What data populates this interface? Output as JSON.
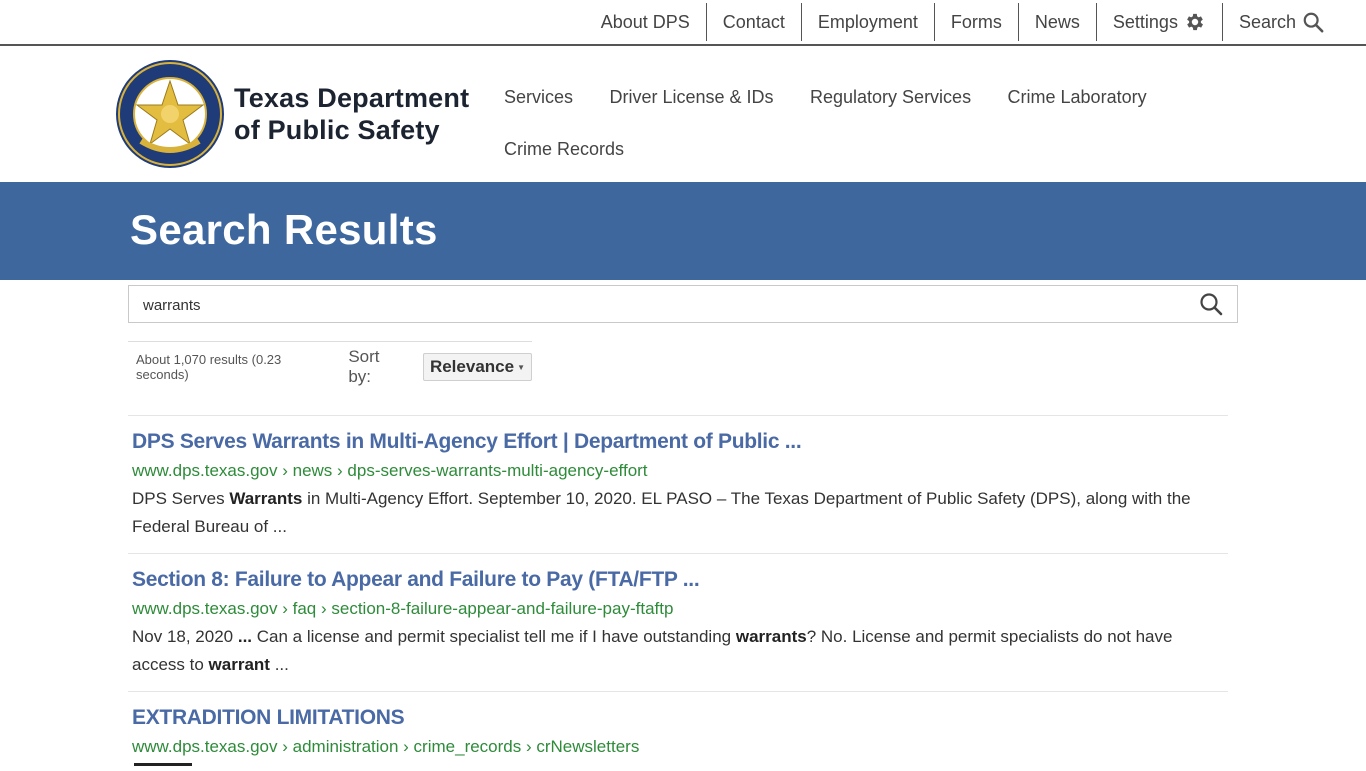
{
  "utility_nav": {
    "about": "About DPS",
    "contact": "Contact",
    "employment": "Employment",
    "forms": "Forms",
    "news": "News",
    "settings": "Settings",
    "search": "Search"
  },
  "brand": {
    "line1": "Texas Department",
    "line2": "of Public Safety"
  },
  "main_nav": {
    "services": "Services",
    "driver_license": "Driver License & IDs",
    "regulatory": "Regulatory Services",
    "crime_lab": "Crime Laboratory",
    "crime_records": "Crime Records"
  },
  "hero": {
    "title": "Search Results"
  },
  "search": {
    "query": "warrants"
  },
  "results_meta": {
    "count_text": "About 1,070 results (0.23 seconds)",
    "sort_label": "Sort by:",
    "sort_value": "Relevance"
  },
  "results": [
    {
      "title": "DPS Serves Warrants in Multi-Agency Effort | Department of Public ...",
      "url": "www.dps.texas.gov › news › dps-serves-warrants-multi-agency-effort",
      "snippet": [
        {
          "t": "DPS Serves ",
          "b": false
        },
        {
          "t": "Warrants",
          "b": true
        },
        {
          "t": " in Multi-Agency Effort. September 10, 2020. EL PASO – The Texas Department of Public Safety (DPS), along with the Federal Bureau of ...",
          "b": false
        }
      ]
    },
    {
      "title": "Section 8: Failure to Appear and Failure to Pay (FTA/FTP ...",
      "url": "www.dps.texas.gov › faq › section-8-failure-appear-and-failure-pay-ftaftp",
      "snippet": [
        {
          "t": "Nov 18, 2020 ",
          "b": false
        },
        {
          "t": "...",
          "b": true
        },
        {
          "t": " Can a license and permit specialist tell me if I have outstanding ",
          "b": false
        },
        {
          "t": "warrants",
          "b": true
        },
        {
          "t": "? No. License and permit specialists do not have access to ",
          "b": false
        },
        {
          "t": "warrant",
          "b": true
        },
        {
          "t": " ...",
          "b": false
        }
      ]
    },
    {
      "title": "EXTRADITION LIMITATIONS",
      "url": "www.dps.texas.gov › administration › crime_records › crNewsletters",
      "snippet": []
    }
  ],
  "colors": {
    "hero_bg": "#3e679e",
    "link_title": "#4a6aa5",
    "url_green": "#2e8b3a",
    "seal_blue": "#1f3b78",
    "seal_gold": "#d8b23a"
  },
  "icons": {
    "settings": "gear-icon",
    "search": "search-icon",
    "seal": "texas-dps-seal"
  }
}
